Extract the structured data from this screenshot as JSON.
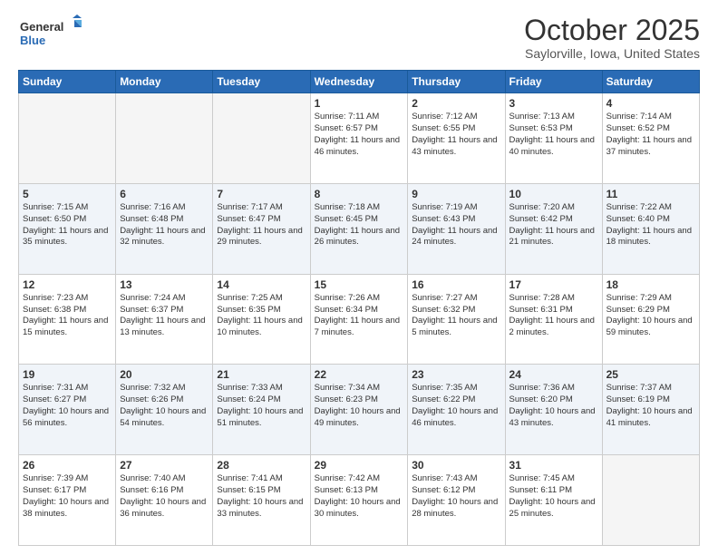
{
  "logo": {
    "line1": "General",
    "line2": "Blue"
  },
  "title": "October 2025",
  "subtitle": "Saylorville, Iowa, United States",
  "days_of_week": [
    "Sunday",
    "Monday",
    "Tuesday",
    "Wednesday",
    "Thursday",
    "Friday",
    "Saturday"
  ],
  "weeks": [
    [
      {
        "day": "",
        "empty": true
      },
      {
        "day": "",
        "empty": true
      },
      {
        "day": "",
        "empty": true
      },
      {
        "day": "1",
        "sunrise": "7:11 AM",
        "sunset": "6:57 PM",
        "daylight": "11 hours and 46 minutes."
      },
      {
        "day": "2",
        "sunrise": "7:12 AM",
        "sunset": "6:55 PM",
        "daylight": "11 hours and 43 minutes."
      },
      {
        "day": "3",
        "sunrise": "7:13 AM",
        "sunset": "6:53 PM",
        "daylight": "11 hours and 40 minutes."
      },
      {
        "day": "4",
        "sunrise": "7:14 AM",
        "sunset": "6:52 PM",
        "daylight": "11 hours and 37 minutes."
      }
    ],
    [
      {
        "day": "5",
        "sunrise": "7:15 AM",
        "sunset": "6:50 PM",
        "daylight": "11 hours and 35 minutes."
      },
      {
        "day": "6",
        "sunrise": "7:16 AM",
        "sunset": "6:48 PM",
        "daylight": "11 hours and 32 minutes."
      },
      {
        "day": "7",
        "sunrise": "7:17 AM",
        "sunset": "6:47 PM",
        "daylight": "11 hours and 29 minutes."
      },
      {
        "day": "8",
        "sunrise": "7:18 AM",
        "sunset": "6:45 PM",
        "daylight": "11 hours and 26 minutes."
      },
      {
        "day": "9",
        "sunrise": "7:19 AM",
        "sunset": "6:43 PM",
        "daylight": "11 hours and 24 minutes."
      },
      {
        "day": "10",
        "sunrise": "7:20 AM",
        "sunset": "6:42 PM",
        "daylight": "11 hours and 21 minutes."
      },
      {
        "day": "11",
        "sunrise": "7:22 AM",
        "sunset": "6:40 PM",
        "daylight": "11 hours and 18 minutes."
      }
    ],
    [
      {
        "day": "12",
        "sunrise": "7:23 AM",
        "sunset": "6:38 PM",
        "daylight": "11 hours and 15 minutes."
      },
      {
        "day": "13",
        "sunrise": "7:24 AM",
        "sunset": "6:37 PM",
        "daylight": "11 hours and 13 minutes."
      },
      {
        "day": "14",
        "sunrise": "7:25 AM",
        "sunset": "6:35 PM",
        "daylight": "11 hours and 10 minutes."
      },
      {
        "day": "15",
        "sunrise": "7:26 AM",
        "sunset": "6:34 PM",
        "daylight": "11 hours and 7 minutes."
      },
      {
        "day": "16",
        "sunrise": "7:27 AM",
        "sunset": "6:32 PM",
        "daylight": "11 hours and 5 minutes."
      },
      {
        "day": "17",
        "sunrise": "7:28 AM",
        "sunset": "6:31 PM",
        "daylight": "11 hours and 2 minutes."
      },
      {
        "day": "18",
        "sunrise": "7:29 AM",
        "sunset": "6:29 PM",
        "daylight": "10 hours and 59 minutes."
      }
    ],
    [
      {
        "day": "19",
        "sunrise": "7:31 AM",
        "sunset": "6:27 PM",
        "daylight": "10 hours and 56 minutes."
      },
      {
        "day": "20",
        "sunrise": "7:32 AM",
        "sunset": "6:26 PM",
        "daylight": "10 hours and 54 minutes."
      },
      {
        "day": "21",
        "sunrise": "7:33 AM",
        "sunset": "6:24 PM",
        "daylight": "10 hours and 51 minutes."
      },
      {
        "day": "22",
        "sunrise": "7:34 AM",
        "sunset": "6:23 PM",
        "daylight": "10 hours and 49 minutes."
      },
      {
        "day": "23",
        "sunrise": "7:35 AM",
        "sunset": "6:22 PM",
        "daylight": "10 hours and 46 minutes."
      },
      {
        "day": "24",
        "sunrise": "7:36 AM",
        "sunset": "6:20 PM",
        "daylight": "10 hours and 43 minutes."
      },
      {
        "day": "25",
        "sunrise": "7:37 AM",
        "sunset": "6:19 PM",
        "daylight": "10 hours and 41 minutes."
      }
    ],
    [
      {
        "day": "26",
        "sunrise": "7:39 AM",
        "sunset": "6:17 PM",
        "daylight": "10 hours and 38 minutes."
      },
      {
        "day": "27",
        "sunrise": "7:40 AM",
        "sunset": "6:16 PM",
        "daylight": "10 hours and 36 minutes."
      },
      {
        "day": "28",
        "sunrise": "7:41 AM",
        "sunset": "6:15 PM",
        "daylight": "10 hours and 33 minutes."
      },
      {
        "day": "29",
        "sunrise": "7:42 AM",
        "sunset": "6:13 PM",
        "daylight": "10 hours and 30 minutes."
      },
      {
        "day": "30",
        "sunrise": "7:43 AM",
        "sunset": "6:12 PM",
        "daylight": "10 hours and 28 minutes."
      },
      {
        "day": "31",
        "sunrise": "7:45 AM",
        "sunset": "6:11 PM",
        "daylight": "10 hours and 25 minutes."
      },
      {
        "day": "",
        "empty": true
      }
    ]
  ],
  "labels": {
    "sunrise": "Sunrise:",
    "sunset": "Sunset:",
    "daylight": "Daylight:"
  }
}
